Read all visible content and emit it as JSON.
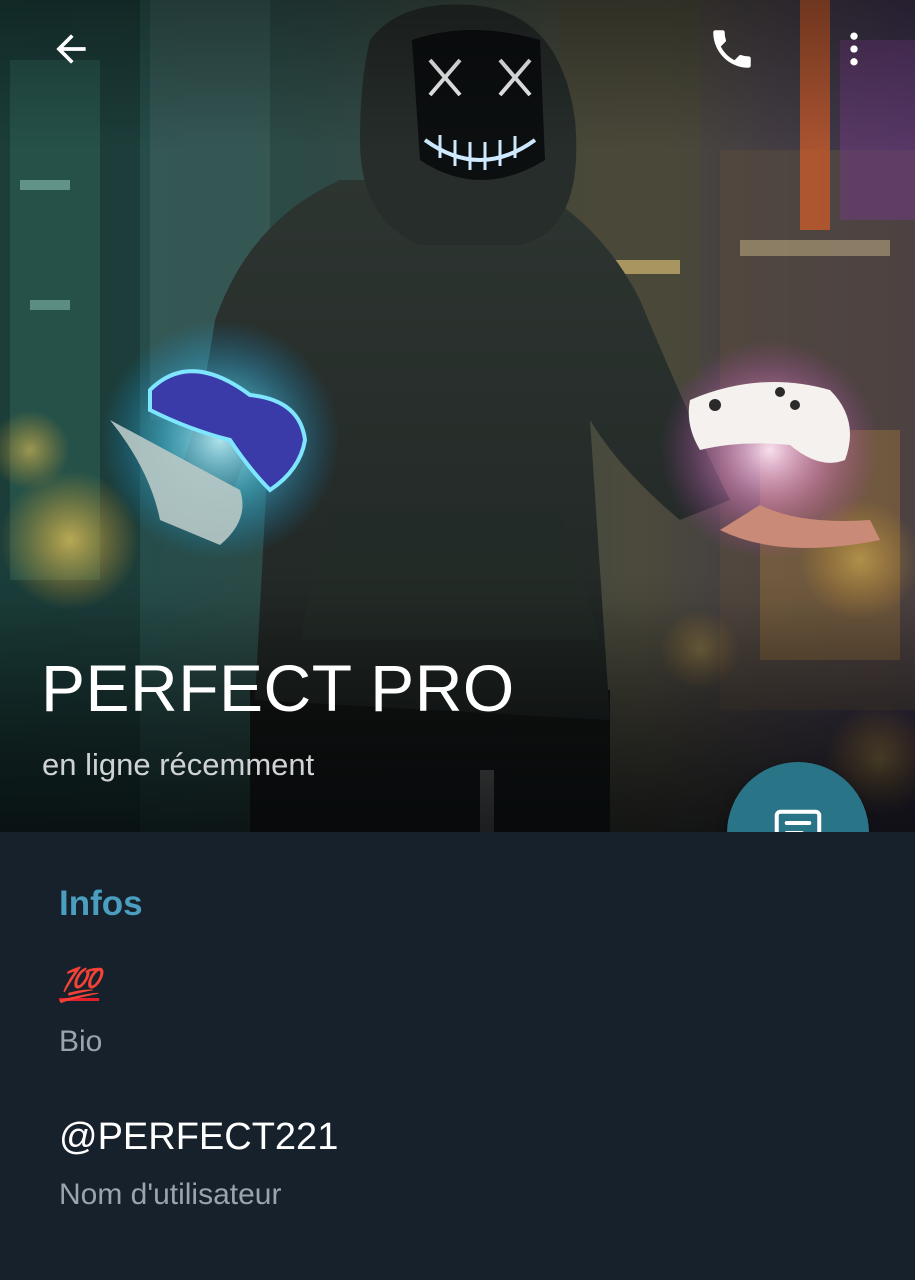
{
  "header": {
    "name": "PERFECT PRO",
    "status": "en ligne récemment",
    "icons": {
      "back": "arrow-left-icon",
      "call": "phone-icon",
      "more": "more-vertical-icon",
      "fab": "message-icon"
    }
  },
  "info": {
    "section_title": "Infos",
    "bio_value": "💯",
    "bio_label": "Bio",
    "username_value": "@PERFECT221",
    "username_label": "Nom d'utilisateur"
  },
  "colors": {
    "background": "#17212b",
    "accent": "#4a9fc0",
    "fab": "#2a7488",
    "secondary_text": "#9aa4ac"
  }
}
